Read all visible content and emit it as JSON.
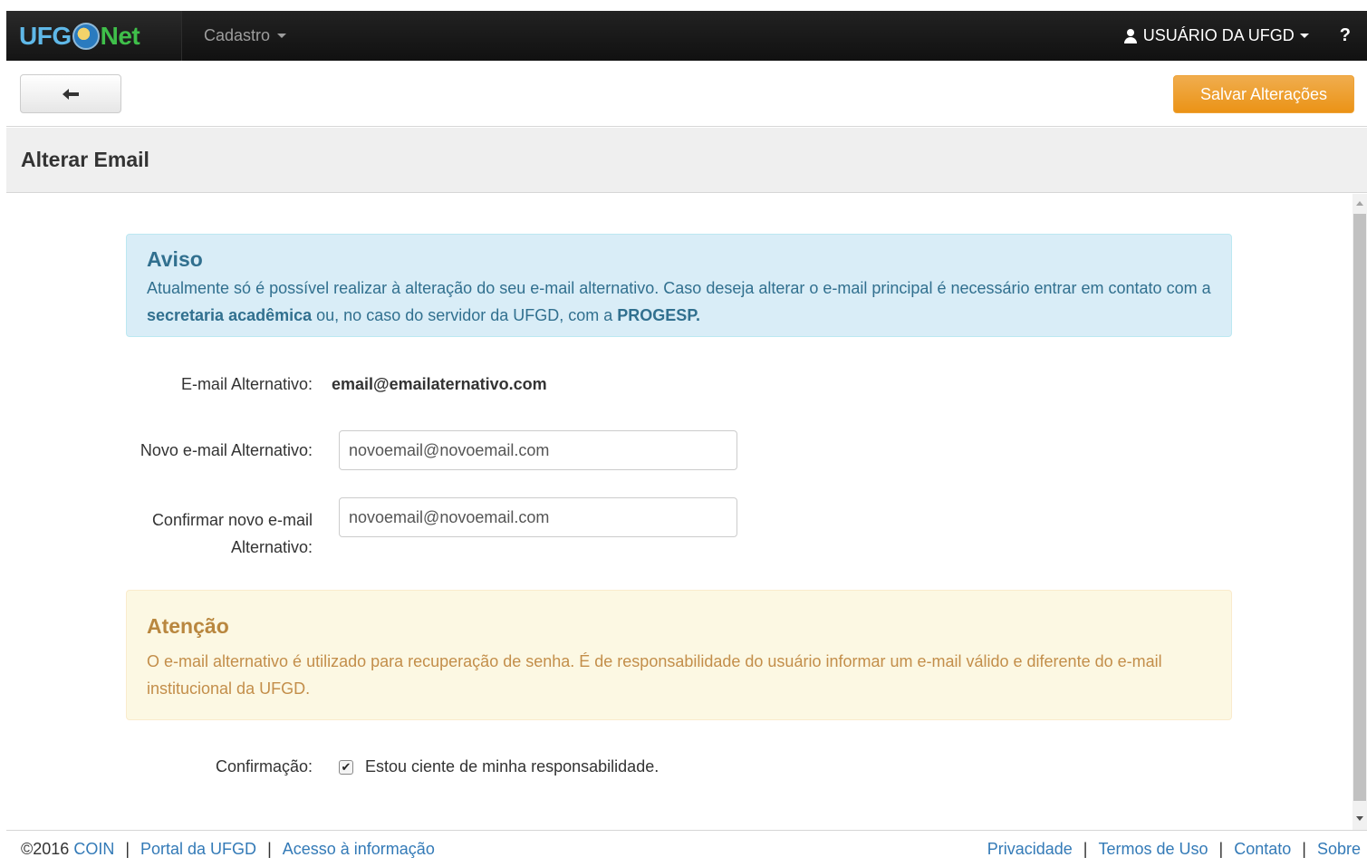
{
  "navbar": {
    "brand_ufg": "UFG",
    "brand_net": "Net",
    "menu_label": "Cadastro",
    "user_label": "USUÁRIO DA UFGD",
    "help_label": "?"
  },
  "toolbar": {
    "save_label": "Salvar Alterações"
  },
  "page": {
    "title": "Alterar Email"
  },
  "info_alert": {
    "title": "Aviso",
    "text_1": "Atualmente só é possível realizar à alteração do seu e-mail alternativo. Caso deseja alterar o e-mail principal é necessário entrar em contato com a ",
    "bold_1": "secretaria acadêmica",
    "text_2": " ou, no caso do servidor da UFGD, com a ",
    "bold_2": "PROGESP."
  },
  "form": {
    "current_label": "E-mail Alternativo:",
    "current_value": "email@emailaternativo.com",
    "new_label": "Novo e-mail Alternativo:",
    "new_value": "novoemail@novoemail.com",
    "confirm_label": "Confirmar novo e-mail Alternativo:",
    "confirm_value": "novoemail@novoemail.com",
    "confirmation_label": "Confirmação:",
    "checkbox_checked": true,
    "checkbox_label": "Estou ciente de minha responsabilidade."
  },
  "warning_alert": {
    "title": "Atenção",
    "text": "O e-mail alternativo é utilizado para recuperação de senha. É de responsabilidade do usuário informar um e-mail válido e diferente do e-mail institucional da UFGD."
  },
  "footer": {
    "copyright": "©2016",
    "left_links": [
      "COIN",
      "Portal da UFGD",
      "Acesso à informação"
    ],
    "right_links": [
      "Privacidade",
      "Termos de Uso",
      "Contato",
      "Sobre"
    ],
    "separator": "|"
  },
  "colors": {
    "navbar_bg": "#111111",
    "save_button": "#f0ad4e",
    "info_bg": "#d9edf7",
    "info_text": "#31708f",
    "warning_bg": "#fcf8e3",
    "warning_text": "#c38e4a",
    "link": "#337ab7"
  }
}
